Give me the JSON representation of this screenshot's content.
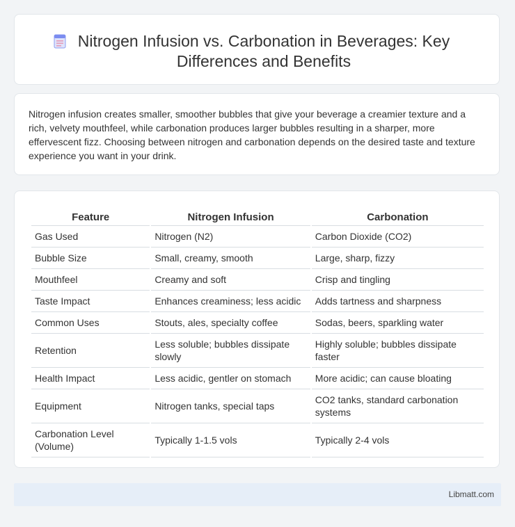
{
  "header": {
    "title": "Nitrogen Infusion vs. Carbonation in Beverages: Key Differences and Benefits",
    "icon": "document-icon"
  },
  "intro": {
    "text": "Nitrogen infusion creates smaller, smoother bubbles that give your beverage a creamier texture and a rich, velvety mouthfeel, while carbonation produces larger bubbles resulting in a sharper, more effervescent fizz. Choosing between nitrogen and carbonation depends on the desired taste and texture experience you want in your drink."
  },
  "table": {
    "headers": [
      "Feature",
      "Nitrogen Infusion",
      "Carbonation"
    ],
    "rows": [
      [
        "Gas Used",
        "Nitrogen (N2)",
        "Carbon Dioxide (CO2)"
      ],
      [
        "Bubble Size",
        "Small, creamy, smooth",
        "Large, sharp, fizzy"
      ],
      [
        "Mouthfeel",
        "Creamy and soft",
        "Crisp and tingling"
      ],
      [
        "Taste Impact",
        "Enhances creaminess; less acidic",
        "Adds tartness and sharpness"
      ],
      [
        "Common Uses",
        "Stouts, ales, specialty coffee",
        "Sodas, beers, sparkling water"
      ],
      [
        "Retention",
        "Less soluble; bubbles dissipate slowly",
        "Highly soluble; bubbles dissipate faster"
      ],
      [
        "Health Impact",
        "Less acidic, gentler on stomach",
        "More acidic; can cause bloating"
      ],
      [
        "Equipment",
        "Nitrogen tanks, special taps",
        "CO2 tanks, standard carbonation systems"
      ],
      [
        "Carbonation Level (Volume)",
        "Typically 1-1.5 vols",
        "Typically 2-4 vols"
      ]
    ]
  },
  "footer": {
    "site": "Libmatt.com"
  },
  "colors": {
    "background": "#f2f4f6",
    "card": "#ffffff",
    "footer": "#e6eef8",
    "icon_accent": "#7b8cf0"
  }
}
